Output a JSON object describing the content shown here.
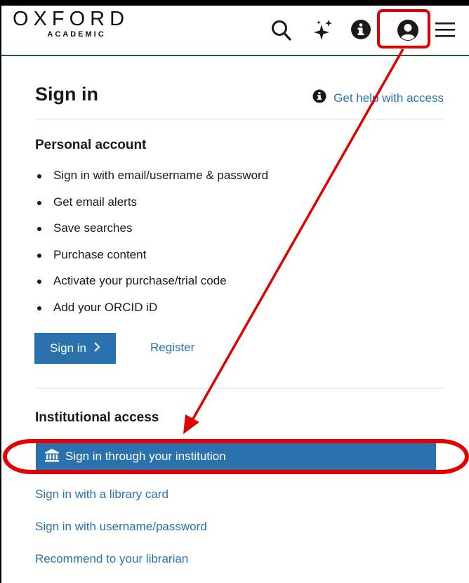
{
  "header": {
    "logo_main": "OXFORD",
    "logo_sub": "ACADEMIC",
    "icons": [
      "search-icon",
      "sparkle-icon",
      "info-icon",
      "account-icon",
      "menu-icon"
    ]
  },
  "signin": {
    "title": "Sign in",
    "help_link": "Get help with access"
  },
  "personal": {
    "heading": "Personal account",
    "features": [
      "Sign in with email/username & password",
      "Get email alerts",
      "Save searches",
      "Purchase content",
      "Activate your purchase/trial code",
      "Add your ORCID iD"
    ],
    "signin_button": "Sign in",
    "register_link": "Register"
  },
  "institutional": {
    "heading": "Institutional access",
    "institution_button": "Sign in through your institution",
    "links": [
      "Sign in with a library card",
      "Sign in with username/password",
      "Recommend to your librarian"
    ]
  },
  "colors": {
    "link": "#2a72ad",
    "button_bg": "#2a72ad",
    "annotation": "#e00000",
    "header_rule": "#2b5a34"
  }
}
